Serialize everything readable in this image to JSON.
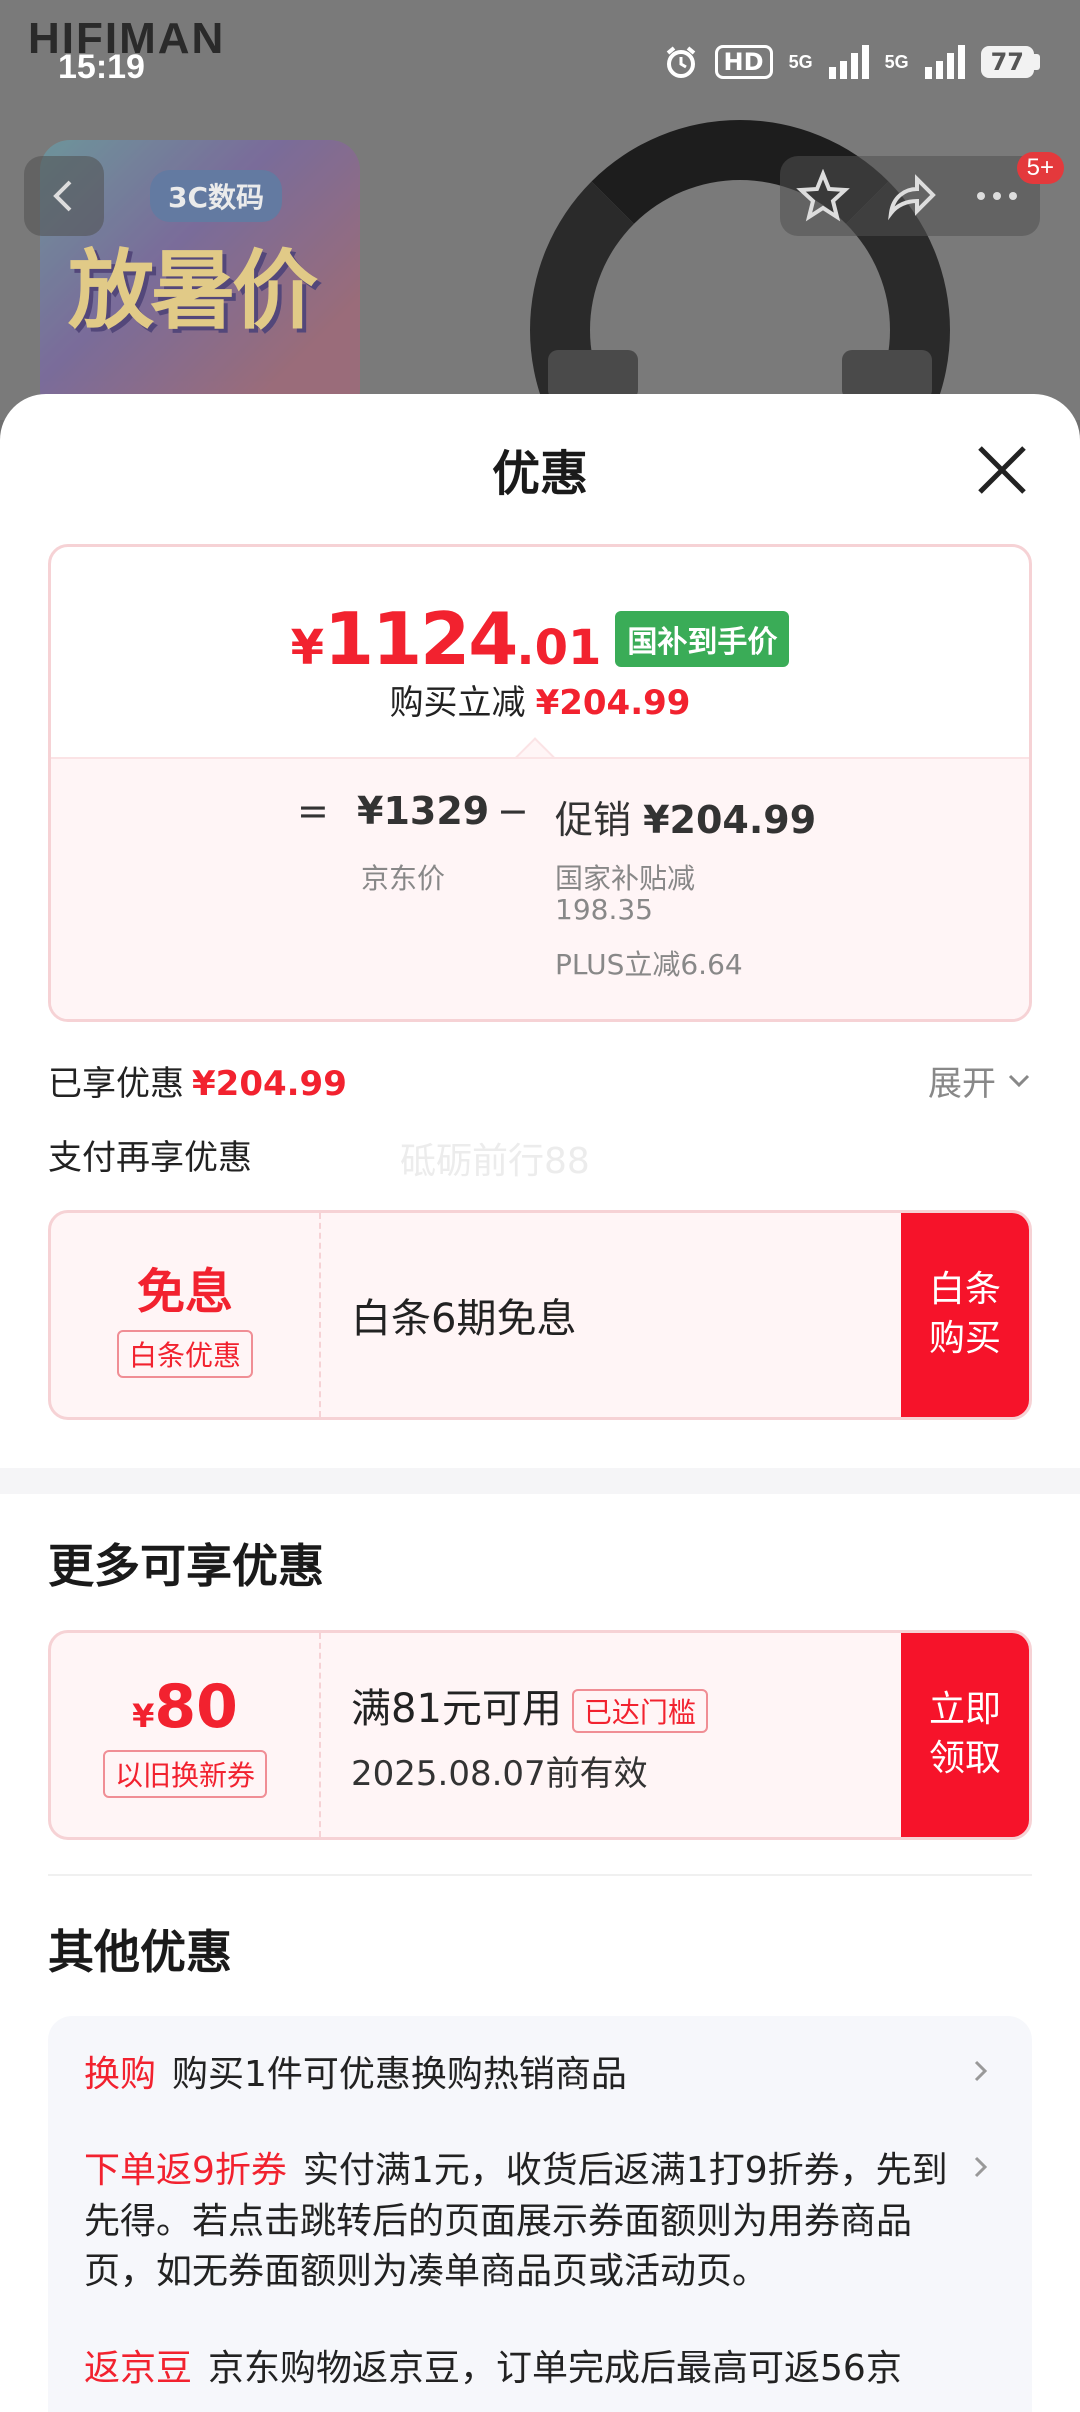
{
  "status_bar": {
    "time": "15:19",
    "hd": "HD",
    "net1": "5G",
    "net2": "5G",
    "battery": "77"
  },
  "background": {
    "brand": "HIFIMAN",
    "art_chip": "3C数码",
    "art_text": "放暑价",
    "cart_badge": "5+"
  },
  "sheet": {
    "title": "优惠",
    "price": {
      "currency": "¥",
      "integer": "1124",
      "decimal": ".01",
      "tag": "国补到手价"
    },
    "discount": {
      "label": "购买立减",
      "value": "¥204.99"
    },
    "breakdown": {
      "eq": "=",
      "jd_price": "¥1329",
      "minus": "−",
      "promo_label": "促销",
      "promo_value": "¥204.99",
      "jd_label": "京东价",
      "sub1_line1": "国家补贴减",
      "sub1_line2": "198.35",
      "sub2": "PLUS立减6.64"
    },
    "enjoyed": {
      "label": "已享优惠",
      "value": "¥204.99",
      "expand": "展开"
    },
    "pay_more": "支付再享优惠",
    "watermark": "砥砺前行88",
    "baitiao": {
      "big": "免息",
      "tag": "白条优惠",
      "text": "白条6期免息",
      "cta_line1": "白条",
      "cta_line2": "购买"
    },
    "more_title": "更多可享优惠",
    "coupon": {
      "currency": "¥",
      "amount": "80",
      "tag": "以旧换新券",
      "condition": "满81元可用",
      "threshold": "已达门槛",
      "expiry": "2025.08.07前有效",
      "cta_line1": "立即",
      "cta_line2": "领取"
    },
    "other_title": "其他优惠",
    "other_offers": [
      {
        "label": "换购",
        "text": "购买1件可优惠换购热销商品"
      },
      {
        "label": "下单返9折券",
        "text": "实付满1元，收货后返满1打9折券，先到先得。若点击跳转后的页面展示券面额则为用券商品页，如无券面额则为凑单商品页或活动页。"
      },
      {
        "label": "返京豆",
        "text": "京东购物返京豆，订单完成后最高可返56京"
      }
    ]
  }
}
